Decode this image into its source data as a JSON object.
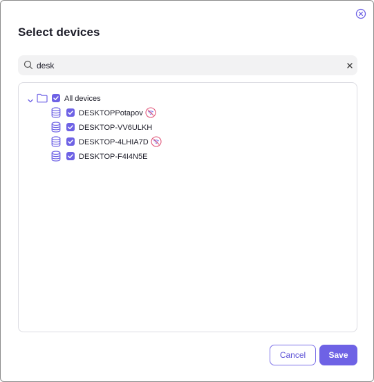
{
  "dialog": {
    "title": "Select devices",
    "close_icon": "close-circle-icon"
  },
  "search": {
    "value": "desk",
    "placeholder": "",
    "icon": "search-icon",
    "clear_icon": "clear-icon"
  },
  "tree": {
    "root": {
      "label": "All devices",
      "checked": true,
      "expanded": true,
      "icon": "folder-icon"
    },
    "devices": [
      {
        "label": "DESKTOPPotapov",
        "checked": true,
        "icon": "database-icon",
        "badge": "offline-badge-icon"
      },
      {
        "label": "DESKTOP-VV6ULKH",
        "checked": true,
        "icon": "database-icon",
        "badge": ""
      },
      {
        "label": "DESKTOP-4LHIA7D",
        "checked": true,
        "icon": "database-icon",
        "badge": "offline-badge-icon"
      },
      {
        "label": "DESKTOP-F4I4N5E",
        "checked": true,
        "icon": "database-icon",
        "badge": ""
      }
    ]
  },
  "footer": {
    "cancel_label": "Cancel",
    "save_label": "Save"
  },
  "colors": {
    "accent": "#6e62e5",
    "badge": "#e0577a",
    "icon": "#6e62e5"
  }
}
